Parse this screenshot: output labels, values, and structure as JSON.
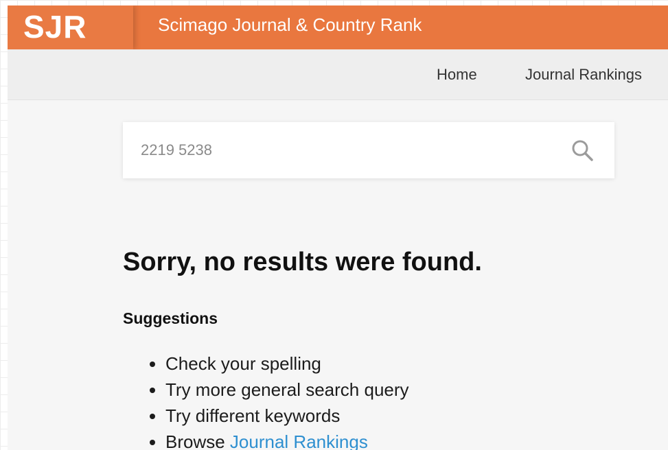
{
  "header": {
    "logo": "SJR",
    "site_title": "Scimago Journal & Country Rank"
  },
  "nav": {
    "home": "Home",
    "journal_rankings": "Journal Rankings"
  },
  "search": {
    "value": "2219 5238",
    "icon": "search-icon"
  },
  "results": {
    "title": "Sorry, no results were found.",
    "suggestions_heading": "Suggestions",
    "suggestions": [
      "Check your spelling",
      "Try more general search query",
      "Try different keywords"
    ],
    "browse_prefix": "Browse ",
    "browse_link": "Journal Rankings"
  },
  "colors": {
    "brand": "#e9773f",
    "nav_bg": "#eeeeee",
    "page_bg": "#f6f6f6",
    "link": "#2e8fd0"
  }
}
